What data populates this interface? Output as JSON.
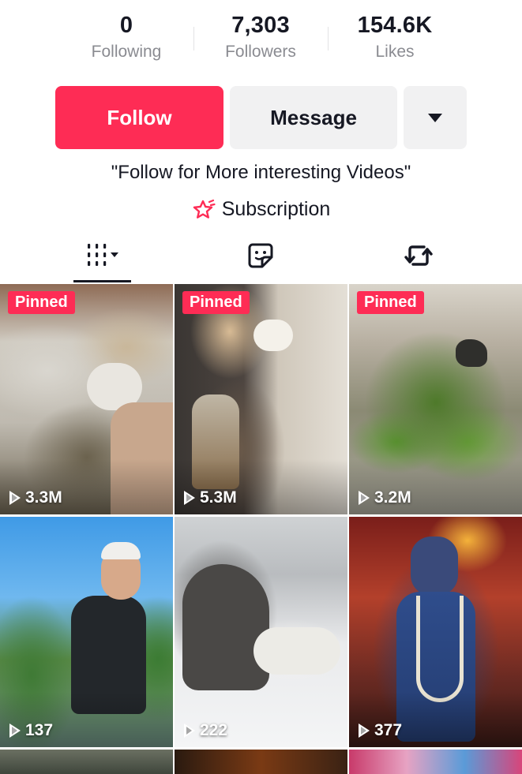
{
  "stats": [
    {
      "value": "0",
      "label": "Following"
    },
    {
      "value": "7,303",
      "label": "Followers"
    },
    {
      "value": "154.6K",
      "label": "Likes"
    }
  ],
  "actions": {
    "follow_label": "Follow",
    "message_label": "Message",
    "more_icon": "caret-down-icon"
  },
  "bio": "\"Follow for More interesting Videos\"",
  "subscription": {
    "label": "Subscription",
    "icon": "subscription-star-icon"
  },
  "tabs": [
    {
      "icon": "videos-grid-icon",
      "active": true
    },
    {
      "icon": "liked-sticker-icon",
      "active": false
    },
    {
      "icon": "repost-icon",
      "active": false
    }
  ],
  "videos": [
    {
      "pinned": true,
      "pinned_label": "Pinned",
      "views": "3.3M",
      "subject": "goat being groomed"
    },
    {
      "pinned": true,
      "pinned_label": "Pinned",
      "views": "5.3M",
      "subject": "woman drinking milk"
    },
    {
      "pinned": true,
      "pinned_label": "Pinned",
      "views": "3.2M",
      "subject": "moss terrarium"
    },
    {
      "pinned": false,
      "views": "137",
      "subject": "fisherman with fish"
    },
    {
      "pinned": false,
      "views": "222",
      "subject": "wolves in snow"
    },
    {
      "pinned": false,
      "views": "377",
      "subject": "dancer in costume"
    }
  ],
  "colors": {
    "accent": "#fe2c55",
    "button_gray": "#f1f1f2",
    "text": "#161823",
    "muted": "#8a8b91"
  }
}
